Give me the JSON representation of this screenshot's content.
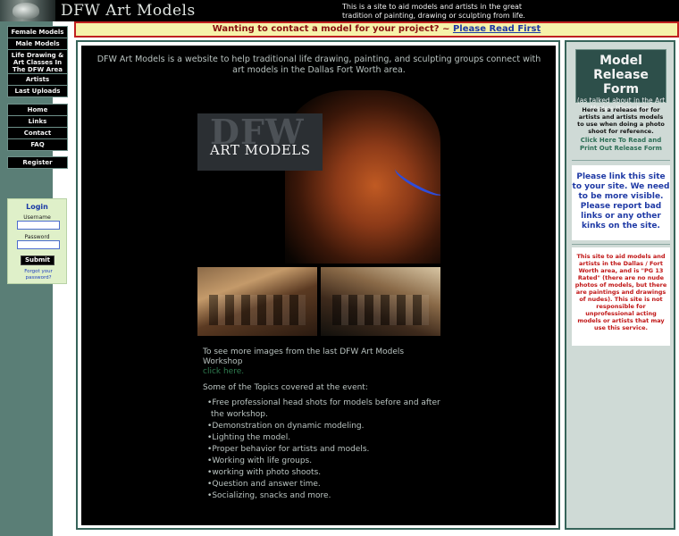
{
  "header": {
    "site_title": "DFW Art Models",
    "tagline": "This is a site to aid models and artists in the great tradition of painting, drawing or sculpting from life."
  },
  "nav": [
    {
      "label": "Female Models"
    },
    {
      "label": "Male Models"
    },
    {
      "label": "Life Drawing & Art Classes In The DFW Area"
    },
    {
      "label": "Artists"
    },
    {
      "label": "Last Uploads"
    },
    {
      "label": "Home"
    },
    {
      "label": "Links"
    },
    {
      "label": "Contact"
    },
    {
      "label": "FAQ"
    },
    {
      "label": "Register"
    }
  ],
  "login": {
    "title": "Login",
    "username_label": "Username",
    "password_label": "Password",
    "submit_label": "Submit",
    "forgot_label": "Forgot your password?"
  },
  "banner": {
    "text": "Wanting to contact a model for your project? ~ ",
    "link": "Please Read First"
  },
  "main": {
    "intro": "DFW Art Models is a website to help traditional life drawing, painting, and sculpting groups connect with art models in the Dallas Fort Worth area.",
    "hero_dfw": "DFW",
    "hero_artmodels": "ART MODELS",
    "see_more": "To see more images from the last DFW Art Models Workshop",
    "see_more_link": "click here.",
    "topics_heading": "Some of the Topics covered at the event:",
    "topics": [
      "Free professional head shots for models before and after the workshop.",
      "Demonstration on dynamic modeling.",
      "Lighting the model.",
      "Proper behavior for artists and models.",
      "Working with life groups.",
      "working with photo shoots.",
      "Question and answer time.",
      "Socializing, snacks and more."
    ]
  },
  "right": {
    "release_title": "Model Release Form",
    "release_sub": "(as talked about in the Art Models Workshop)",
    "release_desc": "Here is a release for for artists and artists models to use when doing a photo shoot for reference.",
    "release_link": "Click Here To Read and Print Out Release Form",
    "link_request": "Please link this site to your site. We need to be more visible. Please report bad links or any other kinks on the site.",
    "info": "This site to aid models and artists in the Dallas / Fort Worth area, and is \"PG 13 Rated\" (there are no nude photos of models, but there are paintings and drawings of nudes). This site is not responsible for unprofessional acting models or artists that may use this service."
  },
  "colors": {
    "sidebar": "#5a7e76",
    "banner_bg": "#f6f2aa",
    "banner_border": "#c02020",
    "link_blue": "#1f3aa5",
    "info_red": "#c01515"
  }
}
